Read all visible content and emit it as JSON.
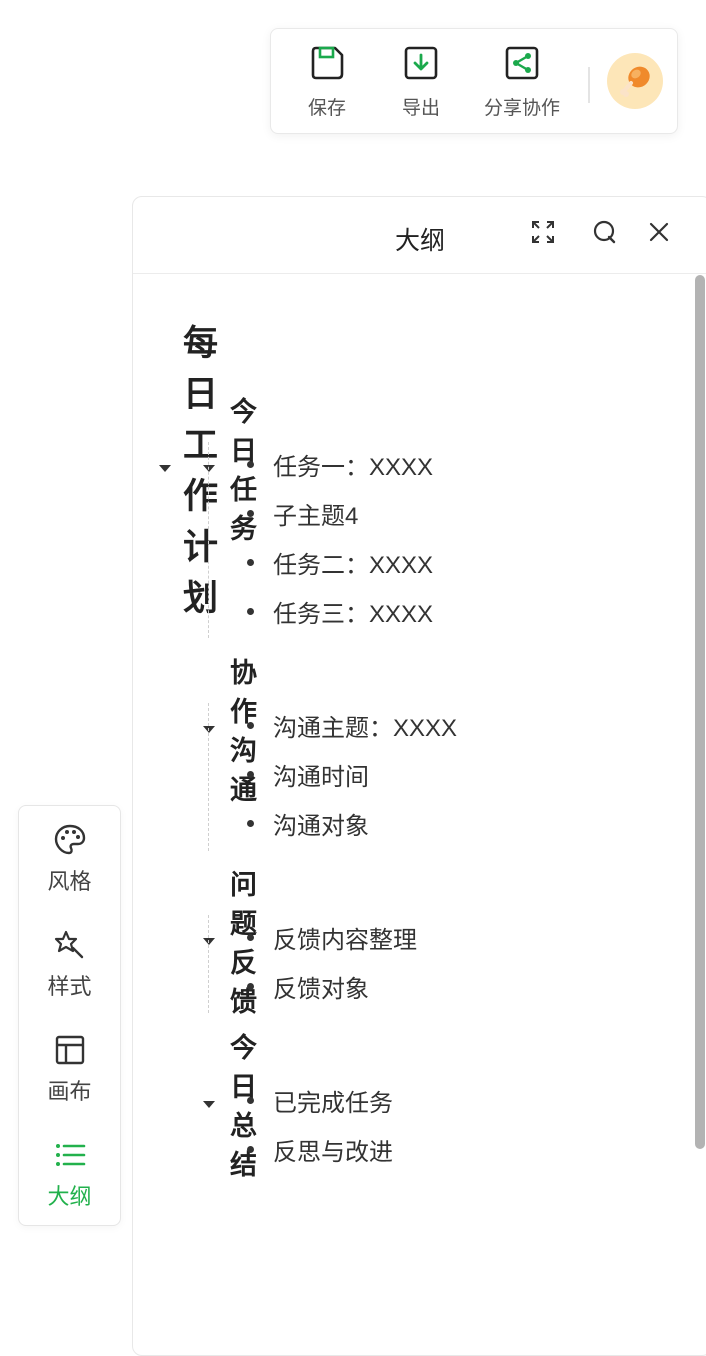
{
  "toolbar": {
    "save_label": "保存",
    "export_label": "导出",
    "share_label": "分享协作",
    "accent": "#1ba94c"
  },
  "outline": {
    "title": "大纲",
    "root": "每日工作计划",
    "sections": [
      {
        "title": "今日任务",
        "items": [
          "任务一：XXXX",
          "子主题4",
          "任务二：XXXX",
          "任务三：XXXX"
        ]
      },
      {
        "title": "协作沟通",
        "items": [
          "沟通主题：XXXX",
          "沟通时间",
          "沟通对象"
        ]
      },
      {
        "title": "问题反馈",
        "items": [
          "反馈内容整理",
          "反馈对象"
        ]
      },
      {
        "title": "今日总结",
        "items": [
          "已完成任务",
          "反思与改进"
        ]
      }
    ]
  },
  "sidebar": {
    "items": [
      {
        "label": "风格",
        "icon": "palette-icon"
      },
      {
        "label": "样式",
        "icon": "magic-star-icon"
      },
      {
        "label": "画布",
        "icon": "layout-icon"
      },
      {
        "label": "大纲",
        "icon": "list-icon",
        "active": true
      }
    ],
    "active_color": "#22b14c"
  }
}
